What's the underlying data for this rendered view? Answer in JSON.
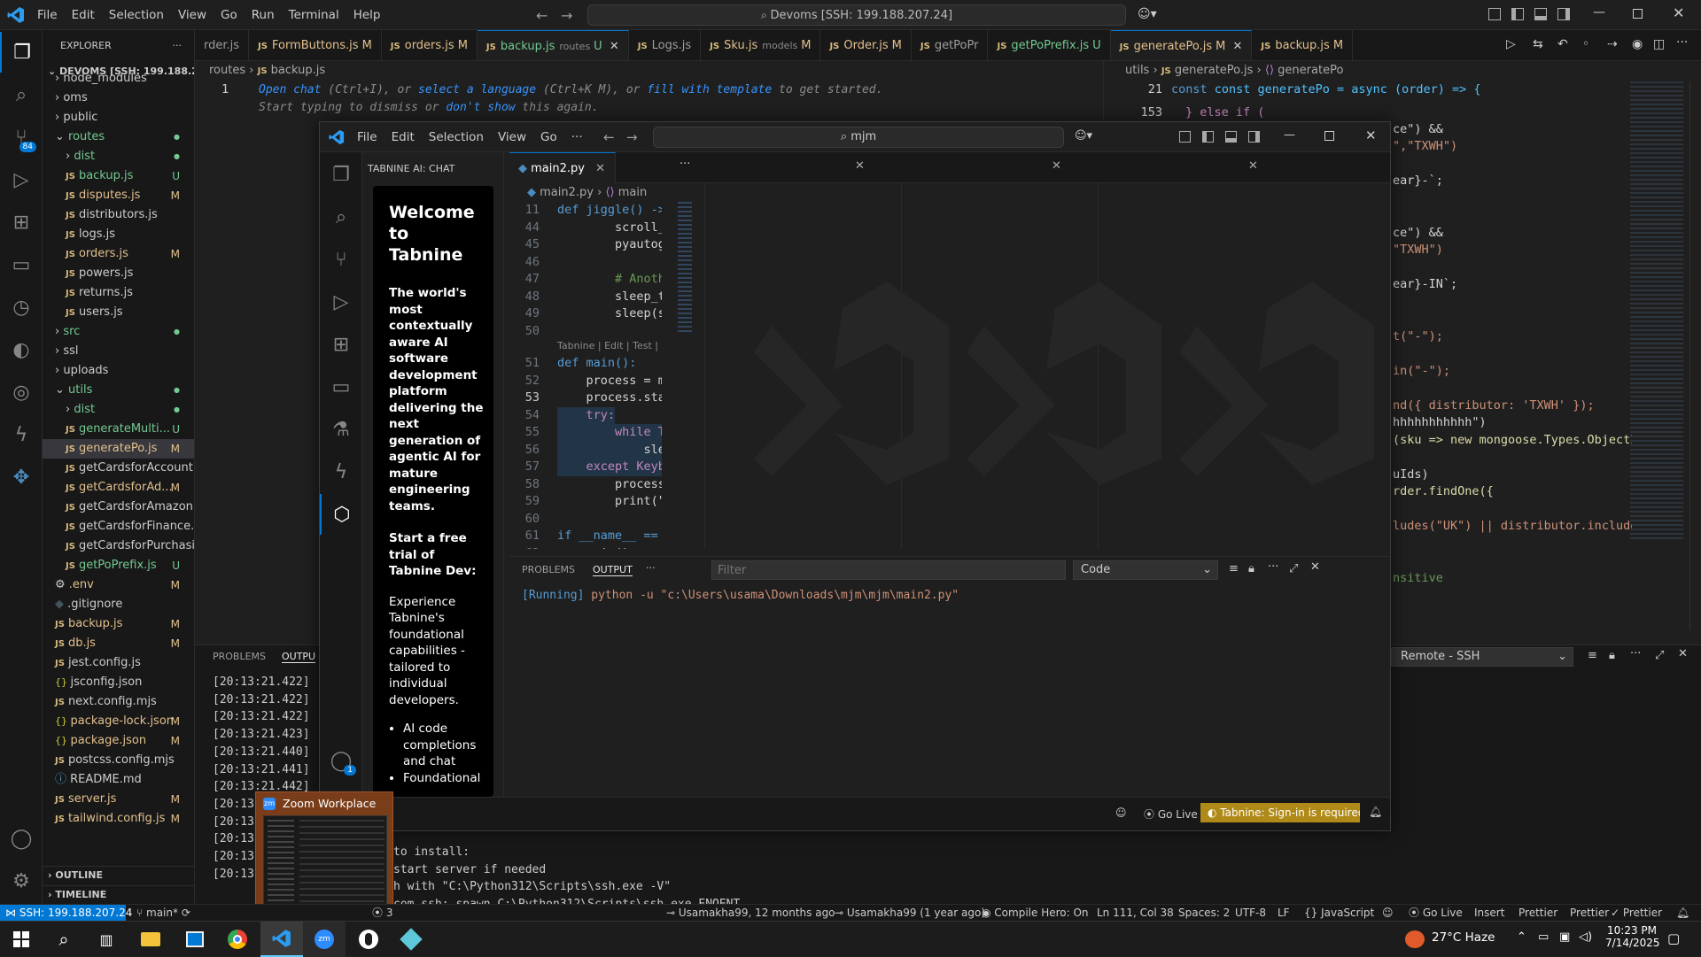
{
  "titlebar": {
    "menu": [
      "File",
      "Edit",
      "Selection",
      "View",
      "Go",
      "Run",
      "Terminal",
      "Help"
    ],
    "search": "Devoms [SSH: 199.188.207.24]"
  },
  "explorer": {
    "title": "EXPLORER",
    "root": "DEVOMS [SSH: 199.188.20...",
    "rows": [
      {
        "label": "node_modules",
        "depth": 1,
        "type": "folder",
        "status": ""
      },
      {
        "label": "oms",
        "depth": 1,
        "type": "folder",
        "status": ""
      },
      {
        "label": "public",
        "depth": 1,
        "type": "folder",
        "status": ""
      },
      {
        "label": "routes",
        "depth": 1,
        "type": "folder-open",
        "status": "dot"
      },
      {
        "label": "dist",
        "depth": 2,
        "type": "folder",
        "status": "dot"
      },
      {
        "label": "backup.js",
        "depth": 2,
        "type": "js",
        "status": "U"
      },
      {
        "label": "disputes.js",
        "depth": 2,
        "type": "js",
        "status": "M"
      },
      {
        "label": "distributors.js",
        "depth": 2,
        "type": "js",
        "status": ""
      },
      {
        "label": "logs.js",
        "depth": 2,
        "type": "js",
        "status": ""
      },
      {
        "label": "orders.js",
        "depth": 2,
        "type": "js",
        "status": "M"
      },
      {
        "label": "powers.js",
        "depth": 2,
        "type": "js",
        "status": ""
      },
      {
        "label": "returns.js",
        "depth": 2,
        "type": "js",
        "status": ""
      },
      {
        "label": "users.js",
        "depth": 2,
        "type": "js",
        "status": ""
      },
      {
        "label": "src",
        "depth": 1,
        "type": "folder",
        "status": "dot"
      },
      {
        "label": "ssl",
        "depth": 1,
        "type": "folder",
        "status": ""
      },
      {
        "label": "uploads",
        "depth": 1,
        "type": "folder",
        "status": ""
      },
      {
        "label": "utils",
        "depth": 1,
        "type": "folder-open",
        "status": "dot"
      },
      {
        "label": "dist",
        "depth": 2,
        "type": "folder",
        "status": "dot"
      },
      {
        "label": "generateMulti...",
        "depth": 2,
        "type": "js",
        "status": "U"
      },
      {
        "label": "generatePo.js",
        "depth": 2,
        "type": "js",
        "status": "M",
        "selected": true
      },
      {
        "label": "getCardsforAccount.js",
        "depth": 2,
        "type": "js",
        "status": ""
      },
      {
        "label": "getCardsforAd...",
        "depth": 2,
        "type": "js",
        "status": "M"
      },
      {
        "label": "getCardsforAmazon.js",
        "depth": 2,
        "type": "js",
        "status": ""
      },
      {
        "label": "getCardsforFinance.js",
        "depth": 2,
        "type": "js",
        "status": ""
      },
      {
        "label": "getCardsforPurchasi...",
        "depth": 2,
        "type": "js",
        "status": ""
      },
      {
        "label": "getPoPrefix.js",
        "depth": 2,
        "type": "js",
        "status": "U"
      },
      {
        "label": ".env",
        "depth": 1,
        "type": "gear",
        "status": "M"
      },
      {
        "label": ".gitignore",
        "depth": 1,
        "type": "git",
        "status": ""
      },
      {
        "label": "backup.js",
        "depth": 1,
        "type": "js",
        "status": "M"
      },
      {
        "label": "db.js",
        "depth": 1,
        "type": "js",
        "status": "M"
      },
      {
        "label": "jest.config.js",
        "depth": 1,
        "type": "js",
        "status": ""
      },
      {
        "label": "jsconfig.json",
        "depth": 1,
        "type": "json",
        "status": ""
      },
      {
        "label": "next.config.mjs",
        "depth": 1,
        "type": "js",
        "status": ""
      },
      {
        "label": "package-lock.json",
        "depth": 1,
        "type": "json",
        "status": "M"
      },
      {
        "label": "package.json",
        "depth": 1,
        "type": "json",
        "status": "M"
      },
      {
        "label": "postcss.config.mjs",
        "depth": 1,
        "type": "js",
        "status": ""
      },
      {
        "label": "README.md",
        "depth": 1,
        "type": "info",
        "status": ""
      },
      {
        "label": "server.js",
        "depth": 1,
        "type": "js",
        "status": "M"
      },
      {
        "label": "tailwind.config.js",
        "depth": 1,
        "type": "js",
        "status": "M"
      }
    ],
    "outline": "OUTLINE",
    "timeline": "TIMELINE"
  },
  "tabs": [
    {
      "label": "rder.js",
      "status": ""
    },
    {
      "label": "FormButtons.js",
      "status": "M"
    },
    {
      "label": "orders.js",
      "status": "M"
    },
    {
      "label": "backup.js",
      "hint": "routes",
      "status": "U",
      "active": true
    },
    {
      "label": "Logs.js",
      "status": ""
    },
    {
      "label": "Sku.js",
      "hint": "models",
      "status": "M"
    },
    {
      "label": "Order.js",
      "status": "M"
    },
    {
      "label": "getPoPr",
      "status": ""
    },
    {
      "label": "getPoPrefix.js",
      "status": "U"
    },
    {
      "label": "generatePo.js",
      "status": "M",
      "active": true
    },
    {
      "label": "backup.js",
      "status": "M"
    }
  ],
  "left_editor": {
    "crumb_a": "routes",
    "crumb_b": "backup.js",
    "line_no": "1",
    "hint_open": "Open chat",
    "hint_a": " (Ctrl+I), or ",
    "hint_select": "select a language",
    "hint_b": " (Ctrl+K M), or ",
    "hint_fill": "fill with template",
    "hint_c": " to get started.",
    "hint_line2a": "Start typing to dismiss or ",
    "hint_dont": "don't show",
    "hint_line2b": " this again."
  },
  "right_editor": {
    "crumb_a": "utils",
    "crumb_b": "generatePo.js",
    "crumb_c": "generatePo",
    "line21_no": "21",
    "line21": "const generatePo = async (order) => {",
    "line153_no": "153",
    "line153": "} else if (",
    "frag": [
      "ce\") &&",
      "\",\"TXWH\")",
      "ear}-`;",
      "ce\") &&",
      "\"TXWH\")",
      "ear}-IN`;",
      "t(\"-\");",
      "in(\"-\");",
      "nd({ distributor: 'TXWH' });",
      "hhhhhhhhhhh\")",
      "(sku => new mongoose.Types.ObjectI",
      "uIds)",
      "rder.findOne({",
      "ludes(\"UK\") || distributor.include",
      "nsitive"
    ]
  },
  "bottom_panel": {
    "tabs": [
      "PROBLEMS",
      "OUTPU"
    ],
    "logs": [
      "[20:13:21.422]",
      "[20:13:21.422]",
      "[20:13:21.422]",
      "[20:13:21.423]",
      "[20:13:21.440]",
      "[20:13:21.441]",
      "[20:13:21.442]",
      "[20:13",
      "[20:13",
      "[20:13",
      "[20:13",
      "[20:13"
    ],
    "terminal": [
      "to install:",
      "start server if needed",
      "h with \"C:\\Python312\\Scripts\\ssh.exe -V\"",
      "com ssh: spawn C:\\Python312\\Scripts\\ssh.exe ENOENT"
    ],
    "remote_select": "Remote - SSH"
  },
  "win2": {
    "menu": [
      "File",
      "Edit",
      "Selection",
      "View",
      "Go",
      "···"
    ],
    "search": "mjm",
    "tabnine_title": "TABNINE AI: CHAT",
    "tn_welcome": "Welcome to Tabnine",
    "tn_desc": "The world's most contextually aware AI software development platform delivering the next generation of agentic AI for mature engineering teams.",
    "tn_trial": "Start a free trial of Tabnine Dev:",
    "tn_exp": "Experience Tabnine's foundational capabilities - tailored to individual developers.",
    "tn_list": [
      "AI code completions and chat",
      "Foundational"
    ],
    "file_tab": "main2.py",
    "crumb_file": "main2.py",
    "crumb_sym": "main",
    "lens": "Tabnine | Edit | Test | E",
    "code": [
      {
        "n": "11",
        "t": "def jiggle() ->"
      },
      {
        "n": "44",
        "t": "        scroll_"
      },
      {
        "n": "45",
        "t": "        pyautog"
      },
      {
        "n": "46",
        "t": ""
      },
      {
        "n": "47",
        "t": "        # Anoth"
      },
      {
        "n": "48",
        "t": "        sleep_t"
      },
      {
        "n": "49",
        "t": "        sleep(s"
      },
      {
        "n": "50",
        "t": ""
      },
      {
        "n": "51",
        "t": "def main():"
      },
      {
        "n": "52",
        "t": "    process = m"
      },
      {
        "n": "53",
        "t": "    process.sta"
      },
      {
        "n": "54",
        "t": "    try:"
      },
      {
        "n": "55",
        "t": "        while T"
      },
      {
        "n": "56",
        "t": "            sle"
      },
      {
        "n": "57",
        "t": "    except Keyb"
      },
      {
        "n": "58",
        "t": "        process"
      },
      {
        "n": "59",
        "t": "        print(\""
      },
      {
        "n": "60",
        "t": ""
      },
      {
        "n": "61",
        "t": "if __name__ =="
      },
      {
        "n": "62",
        "t": "    main()"
      }
    ],
    "panel_tabs": [
      "PROBLEMS",
      "OUTPUT",
      "···"
    ],
    "filter_placeholder": "Filter",
    "select_value": "Code",
    "output_running": "[Running]",
    "output_cmd": " python -u \"c:\\Users\\usama\\Downloads\\mjm\\mjm\\main2.py\"",
    "status_golive": "Go Live",
    "status_tabnine": "Tabnine: Sign-in is required"
  },
  "zoom_popup": {
    "title": "Zoom Workplace"
  },
  "statusbar": {
    "remote": "SSH: 199.188.207.24",
    "branch": "main*",
    "ports": "3",
    "blame1": "Usamakha99, 12 months ago",
    "blame2": "Usamakha99 (1 year ago)",
    "compile": "Compile Hero: On",
    "position": "Ln 111, Col 38",
    "spaces": "Spaces: 2",
    "encoding": "UTF-8",
    "eol": "LF",
    "lang": "JavaScript",
    "golive": "Go Live",
    "insert": "Insert",
    "prettier1": "Prettier",
    "prettier2": "Prettier",
    "prettier3": "Prettier"
  },
  "taskbar": {
    "weather": "27°C Haze",
    "time": "10:23 PM",
    "date": "7/14/2025"
  },
  "colors": {
    "accent": "#0078d4",
    "modified": "#e2c08d",
    "untracked": "#73c991",
    "tabnine_warn": "#b08a18"
  }
}
